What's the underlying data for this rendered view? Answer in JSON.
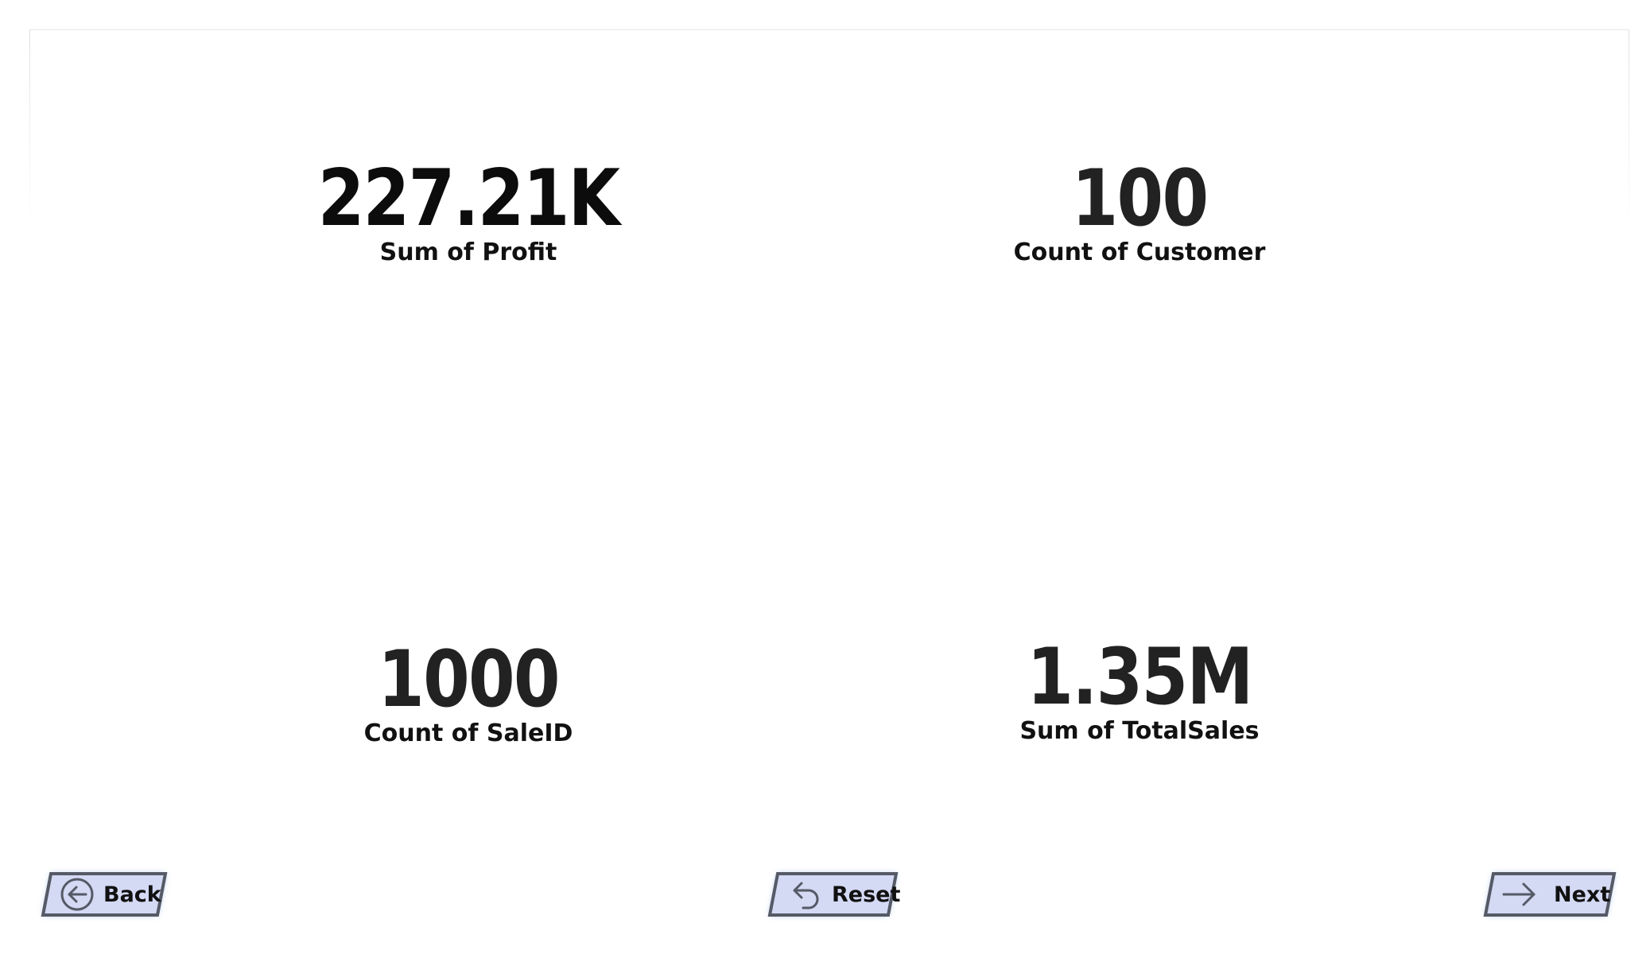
{
  "cards": [
    {
      "value": "227.21K",
      "label": "Sum of Profit"
    },
    {
      "value": "100",
      "label": "Count of Customer"
    },
    {
      "value": "1000",
      "label": "Count of SaleID"
    },
    {
      "value": "1.35M",
      "label": "Sum of TotalSales"
    }
  ],
  "nav": {
    "back_label": "Back",
    "reset_label": "Reset",
    "next_label": "Next"
  },
  "icons": {
    "back": "arrow-left-circle-icon",
    "reset": "undo-arrow-icon",
    "next": "arrow-right-icon"
  },
  "colors": {
    "button_fill": "#d4d9f4",
    "button_border": "#555a66",
    "button_glow": "#7ea8e8",
    "value_text": "#222222",
    "label_text": "#111111"
  }
}
